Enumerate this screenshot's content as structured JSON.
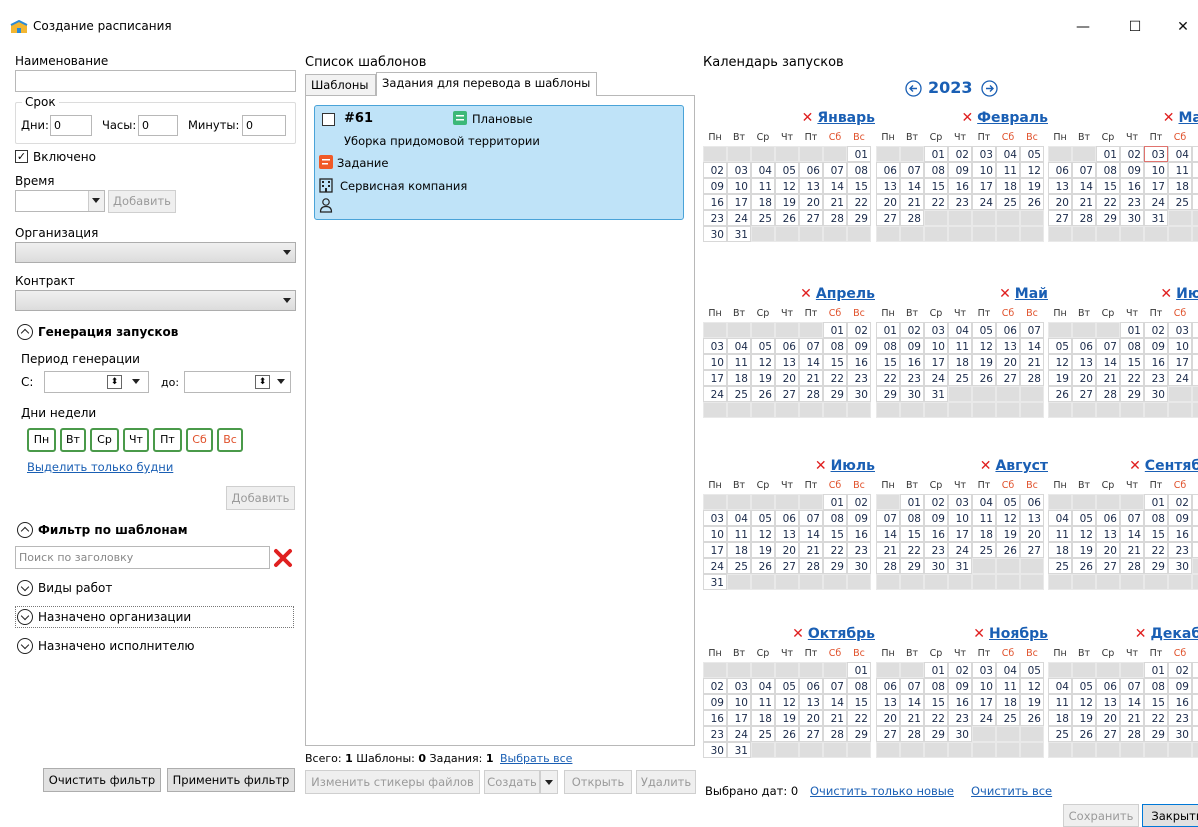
{
  "window": {
    "title": "Создание расписания",
    "min": "—",
    "max": "☐",
    "close": "✕"
  },
  "left": {
    "name_label": "Наименование",
    "name_value": "",
    "term_label": "Срок",
    "days_label": "Дни:",
    "days_value": "0",
    "hours_label": "Часы:",
    "hours_value": "0",
    "minutes_label": "Минуты:",
    "minutes_value": "0",
    "enabled_label": "Включено",
    "time_label": "Время",
    "time_add": "Добавить",
    "org_label": "Организация",
    "contract_label": "Контракт",
    "gen_label": "Генерация запусков",
    "period_label": "Период генерации",
    "from_label": "С:",
    "to_label": "до:",
    "weekdays_label": "Дни недели",
    "weekdays": [
      "Пн",
      "Вт",
      "Ср",
      "Чт",
      "Пт",
      "Сб",
      "Вс"
    ],
    "select_weekdays": "Выделить только будни",
    "add_button": "Добавить",
    "filter_label": "Фильтр по шаблонам",
    "search_placeholder": "Поиск по заголовку",
    "work_types": "Виды работ",
    "assigned_org": "Назначено организации",
    "assigned_exec": "Назначено исполнителю",
    "clear_filter": "Очистить фильтр",
    "apply_filter": "Применить фильтр"
  },
  "middle": {
    "title": "Список шаблонов",
    "tabs": [
      "Шаблоны",
      "Задания для перевода в шаблоны"
    ],
    "card": {
      "number": "#61",
      "category": "Плановые",
      "name": "Уборка придомовой территории",
      "type": "Задание",
      "company": "Сервисная компания"
    },
    "summary_all_label": "Всего:",
    "summary_all": "1",
    "summary_templates_label": "Шаблоны:",
    "summary_templates": "0",
    "summary_tasks_label": "Задания:",
    "summary_tasks": "1",
    "select_all": "Выбрать все",
    "edit_stickers": "Изменить стикеры файлов",
    "create": "Создать",
    "open": "Открыть",
    "delete": "Удалить"
  },
  "calendar": {
    "title": "Календарь запусков",
    "year": "2023",
    "dow": [
      "Пн",
      "Вт",
      "Ср",
      "Чт",
      "Пт",
      "Сб",
      "Вс"
    ],
    "months": [
      {
        "name": "Январь",
        "first": 6,
        "days": 31
      },
      {
        "name": "Февраль",
        "first": 2,
        "days": 28
      },
      {
        "name": "Март",
        "first": 2,
        "days": 31,
        "highlight": 3
      },
      {
        "name": "Апрель",
        "first": 5,
        "days": 30
      },
      {
        "name": "Май",
        "first": 0,
        "days": 31
      },
      {
        "name": "Июнь",
        "first": 3,
        "days": 30
      },
      {
        "name": "Июль",
        "first": 5,
        "days": 31
      },
      {
        "name": "Август",
        "first": 1,
        "days": 31
      },
      {
        "name": "Сентябрь",
        "first": 4,
        "days": 30
      },
      {
        "name": "Октябрь",
        "first": 6,
        "days": 31
      },
      {
        "name": "Ноябрь",
        "first": 2,
        "days": 30
      },
      {
        "name": "Декабрь",
        "first": 4,
        "days": 31
      }
    ],
    "selected_label": "Выбрано дат:",
    "selected_count": "0",
    "clear_new": "Очистить только новые",
    "clear_all": "Очистить все",
    "save": "Сохранить",
    "close": "Закрыть"
  },
  "colors": {
    "accent": "#1a5fb4",
    "card_bg": "#bfe3f8",
    "weekend": "#e0502a",
    "remove": "#e02020",
    "day_border": "#4a9a4a"
  }
}
